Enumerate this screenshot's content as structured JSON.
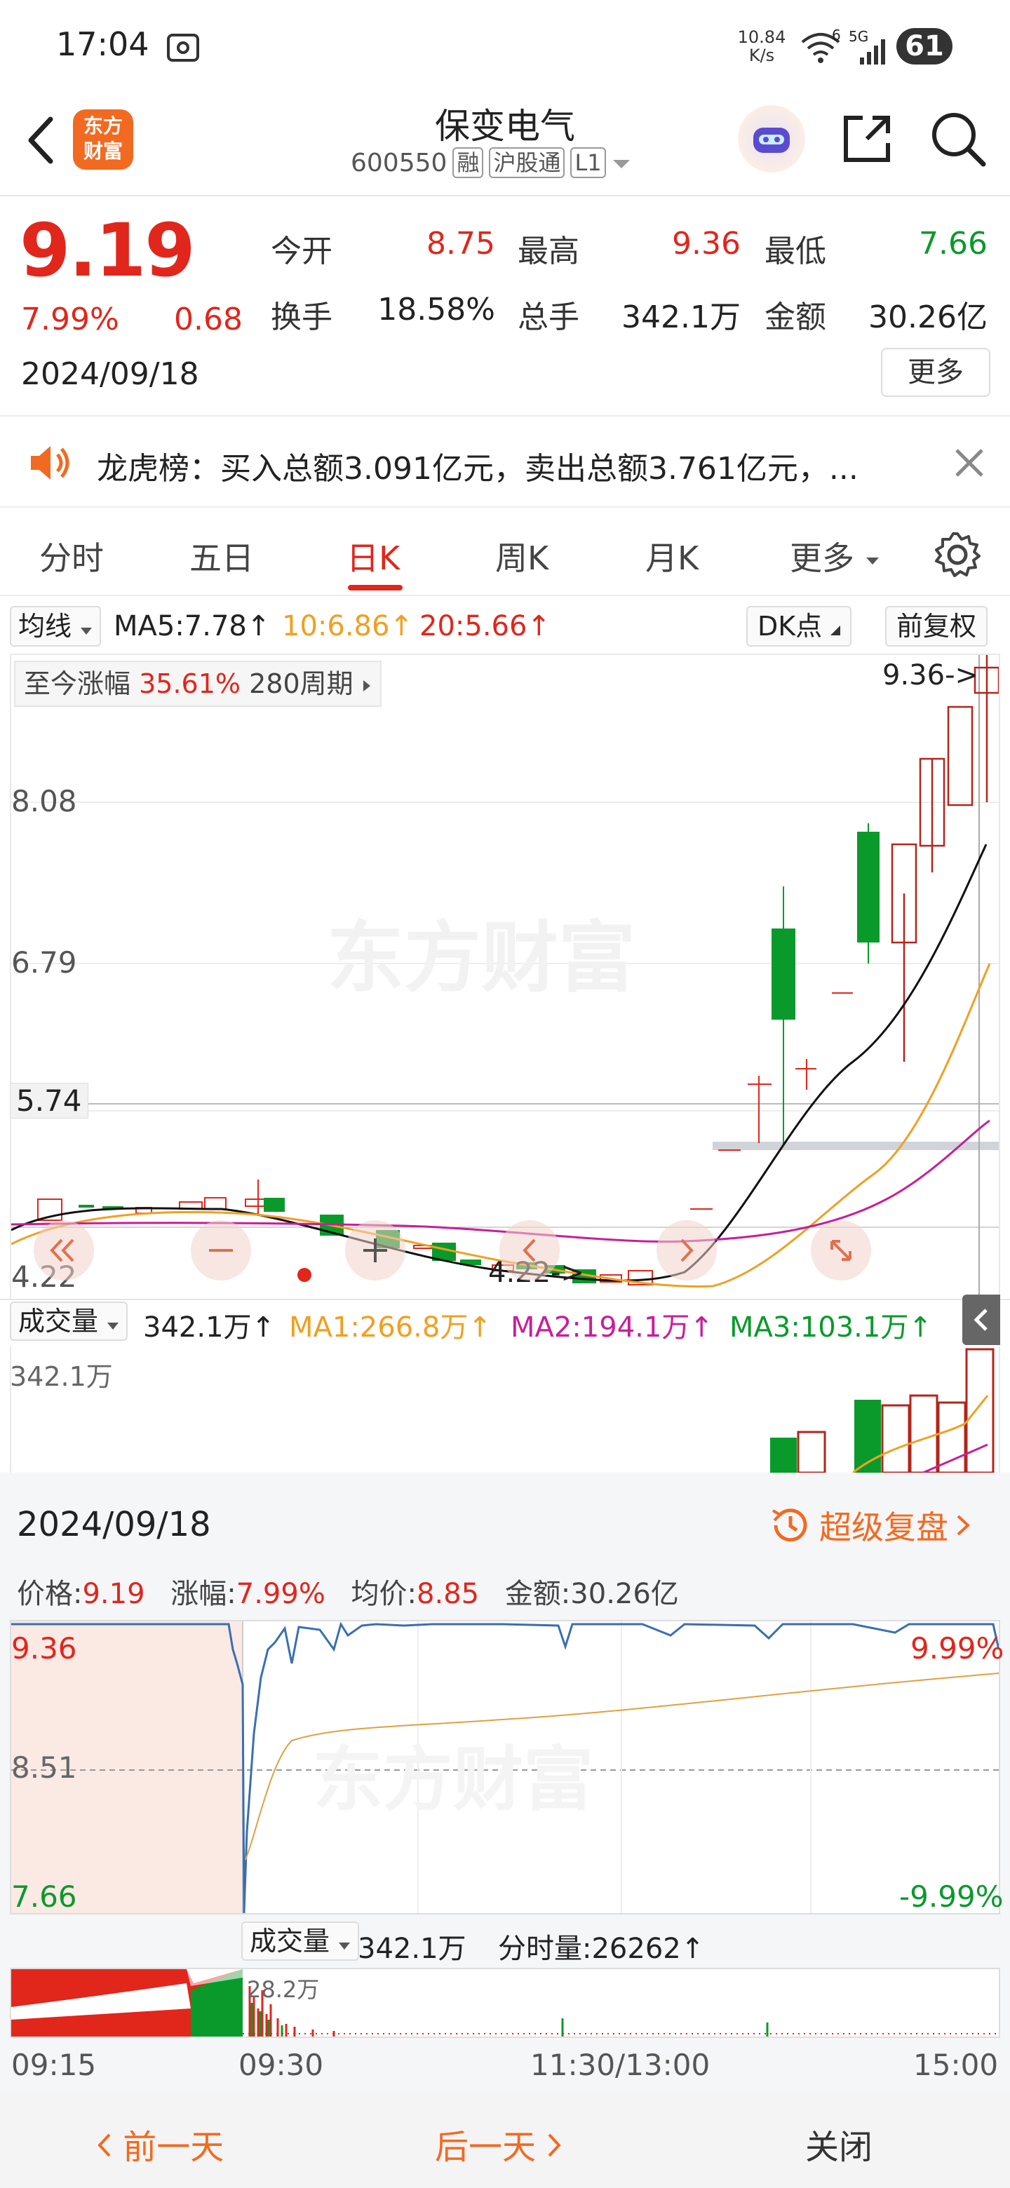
{
  "status_bar": {
    "time": "17:04",
    "net_speed_value": "10.84",
    "net_speed_unit": "K/s",
    "signal_label": "5G",
    "wifi_label": "6",
    "battery": "61"
  },
  "header": {
    "logo_line1": "东方",
    "logo_line2": "财富",
    "stock_name": "保变电气",
    "stock_code": "600550",
    "tags": [
      "融",
      "沪股通",
      "L1"
    ]
  },
  "quote": {
    "price": "9.19",
    "change_pct": "7.99%",
    "change_amt": "0.68",
    "date": "2024/09/18",
    "open_label": "今开",
    "open": "8.75",
    "high_label": "最高",
    "high": "9.36",
    "low_label": "最低",
    "low": "7.66",
    "turnover_label": "换手",
    "turnover": "18.58%",
    "volume_label": "总手",
    "volume": "342.1万",
    "amount_label": "金额",
    "amount": "30.26亿",
    "more_label": "更多"
  },
  "notice": {
    "text": "龙虎榜：买入总额3.091亿元，卖出总额3.761亿元，..."
  },
  "tabs": [
    "分时",
    "五日",
    "日K",
    "周K",
    "月K",
    "更多"
  ],
  "active_tab": 2,
  "kline": {
    "ma_selector": "均线",
    "ma5": "MA5:7.78",
    "ma10": "10:6.86",
    "ma20": "20:5.66",
    "dk_label": "DK点",
    "adjust_label": "前复权",
    "period_label": "至今涨幅",
    "period_pct": "35.61%",
    "period_count": "280周期",
    "y_labels": [
      "8.08",
      "6.79",
      "5.74",
      "4.22"
    ],
    "high_marker": "9.36->",
    "low_marker": "4.22->",
    "watermark": "东方财富",
    "colors": {
      "up": "#e1261c",
      "down": "#0a9a2c",
      "ma5": "#111111",
      "ma10": "#f0a020",
      "ma20": "#c81e9a"
    }
  },
  "volume_panel": {
    "selector": "成交量",
    "value": "342.1万",
    "ma1": "MA1:266.8万",
    "ma2": "MA2:194.1万",
    "ma3": "MA3:103.1万",
    "top_label": "342.1万"
  },
  "replay": {
    "date": "2024/09/18",
    "link_label": "超级复盘",
    "price_label": "价格:",
    "price": "9.19",
    "change_label": "涨幅:",
    "change": "7.99%",
    "avg_label": "均价:",
    "avg": "8.85",
    "amount_label": "金额:",
    "amount": "30.26亿",
    "y_top": "9.36",
    "y_mid": "8.51",
    "y_bot": "7.66",
    "pct_top": "9.99%",
    "pct_bot": "-9.99%",
    "vol_selector": "成交量",
    "vol_value": "342.1万",
    "tick_vol_label": "分时量:",
    "tick_vol": "26262",
    "vol_peak": "28.2万",
    "times": [
      "09:15",
      "09:30",
      "11:30/13:00",
      "15:00"
    ]
  },
  "bottom_nav": {
    "prev": "前一天",
    "next": "后一天",
    "close": "关闭"
  }
}
